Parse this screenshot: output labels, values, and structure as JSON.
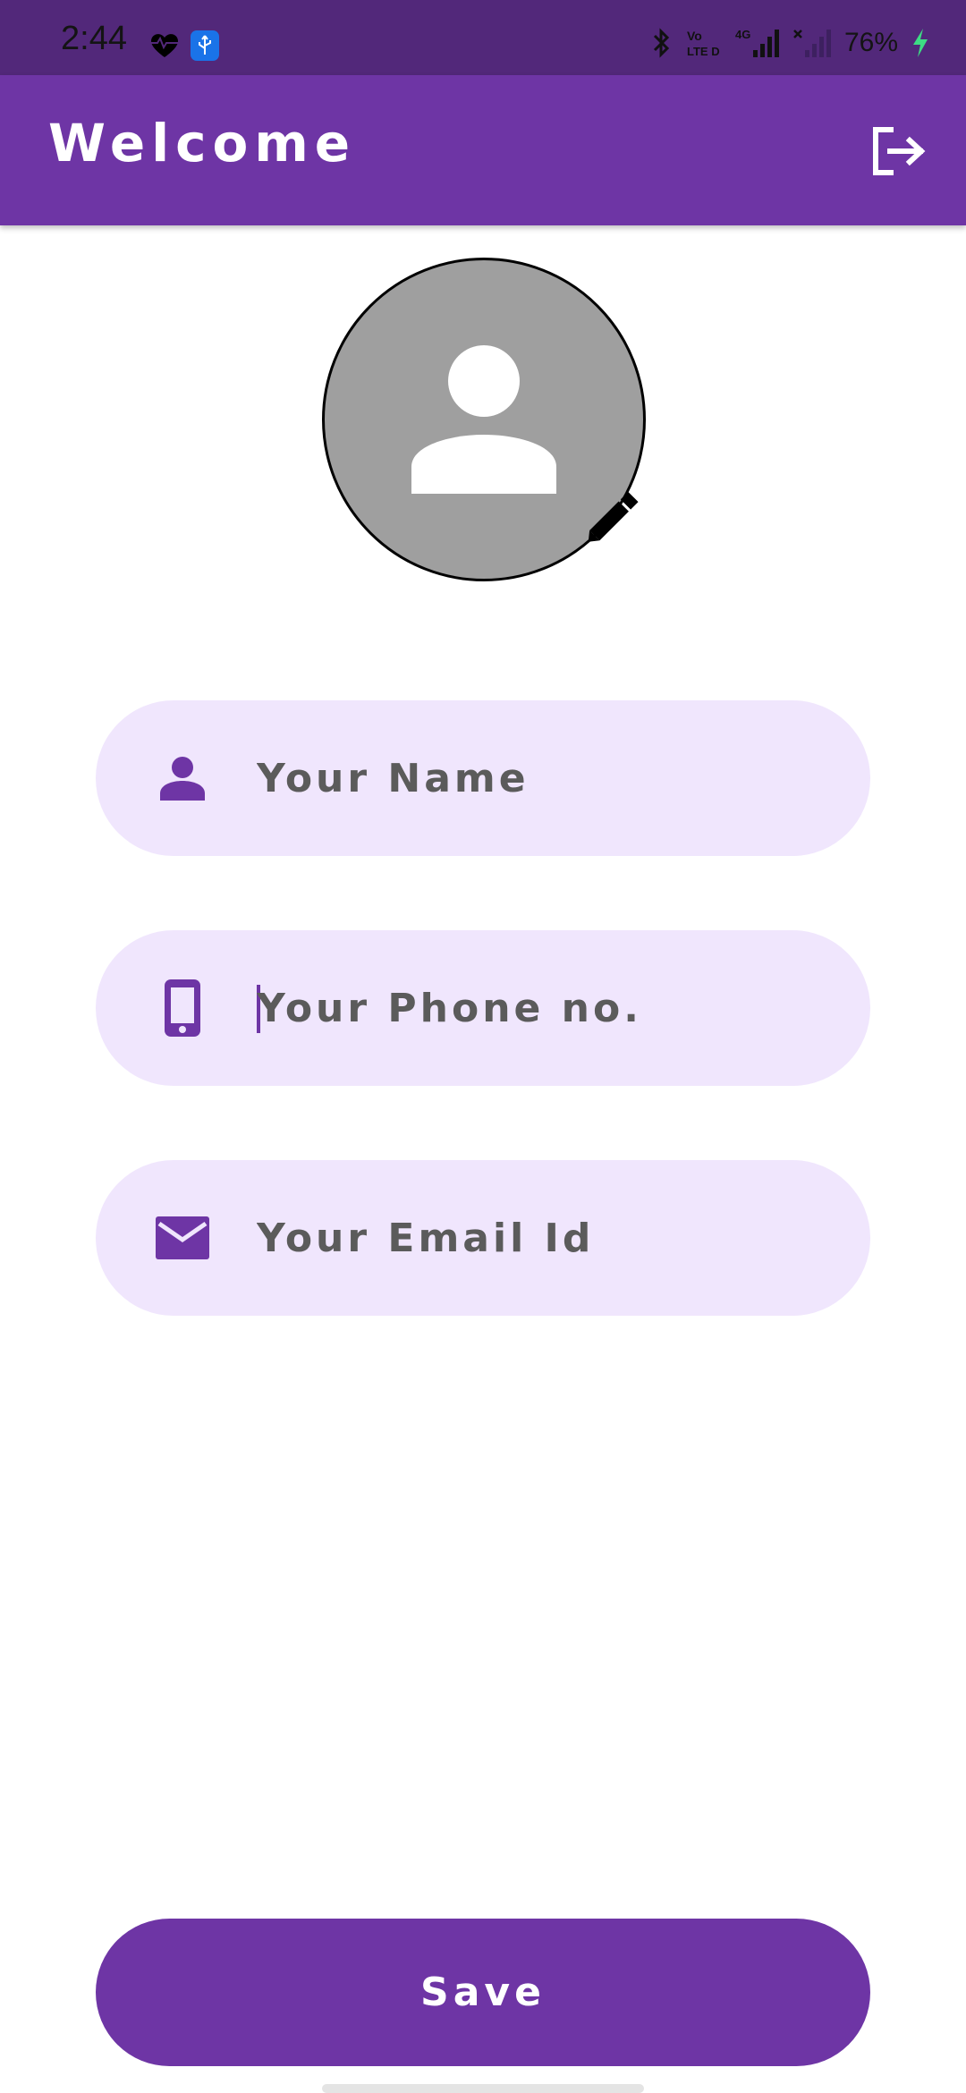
{
  "status_bar": {
    "time": "2:44",
    "battery_text": "76%",
    "icons": [
      "heart-monitor-icon",
      "usb-icon",
      "bluetooth-icon",
      "volte-icon",
      "signal-4g-icon",
      "signal-no-service-icon",
      "charging-icon"
    ]
  },
  "app_bar": {
    "title": "Welcome",
    "logout_icon": "logout-icon"
  },
  "avatar": {
    "icon": "person-icon",
    "edit_icon": "pencil-icon"
  },
  "form": {
    "name": {
      "placeholder": "Your Name",
      "icon": "person-icon"
    },
    "phone": {
      "placeholder": "Your Phone no.",
      "icon": "smartphone-icon"
    },
    "email": {
      "placeholder": "Your Email Id",
      "icon": "mail-icon"
    }
  },
  "actions": {
    "save_label": "Save"
  },
  "colors": {
    "primary": "#6e35a5",
    "status_bar": "#52287a",
    "field_background": "#f0e6fd",
    "avatar_background": "#9f9f9f"
  }
}
